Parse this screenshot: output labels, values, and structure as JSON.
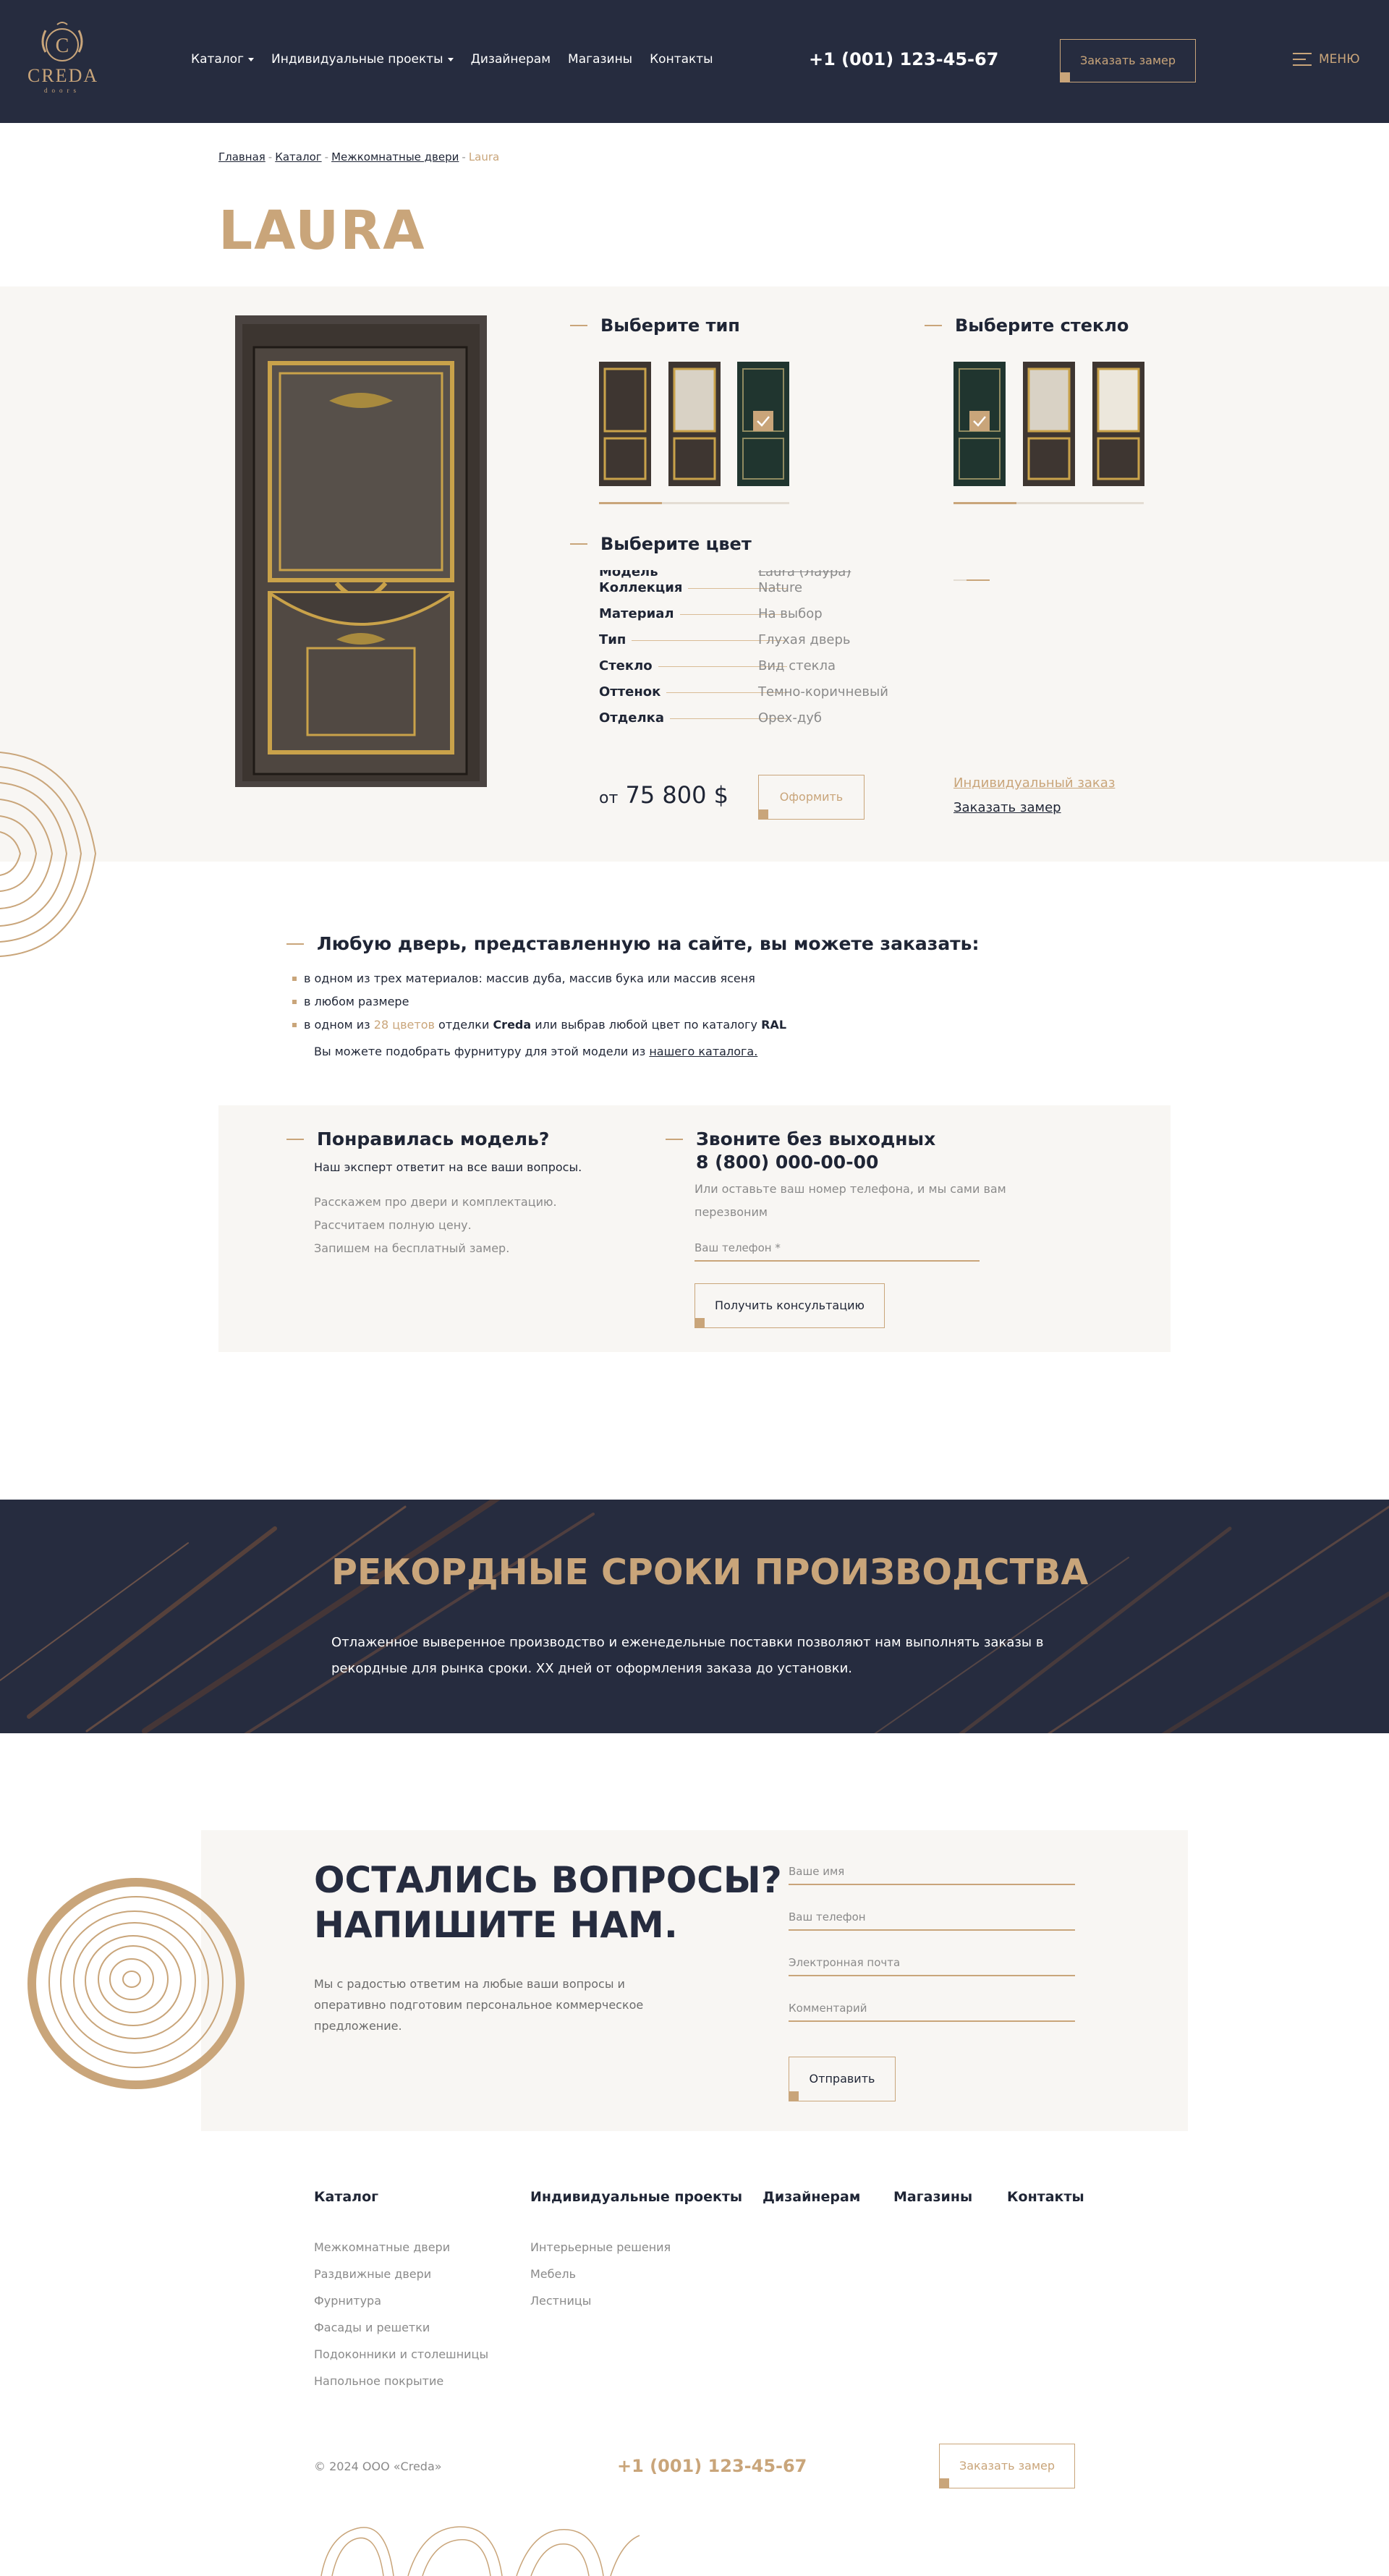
{
  "header": {
    "logo_text": "CREDA",
    "logo_sub": "doors",
    "nav": [
      "Каталог",
      "Индивидуальные проекты",
      "Дизайнерам",
      "Магазины",
      "Контакты"
    ],
    "phone": "+1 (001) 123-45-67",
    "measure_button": "Заказать замер",
    "menu": "МЕНЮ"
  },
  "breadcrumb": [
    "Главная",
    "Каталог",
    "Межкомнатные двери",
    "Laura"
  ],
  "title": "LAURA",
  "product": {
    "type_title": "Выберите тип",
    "glass_title": "Выберите стекло",
    "color_title": "Выберите цвет",
    "specs": [
      {
        "k": "Модель",
        "v": "Laura (Лаура)"
      },
      {
        "k": "Коллекция",
        "v": "Nature"
      },
      {
        "k": "Материал",
        "v": "На выбор"
      },
      {
        "k": "Тип",
        "v": "Глухая дверь"
      },
      {
        "k": "Стекло",
        "v": "Вид стекла"
      },
      {
        "k": "Оттенок",
        "v": "Темно-коричневый"
      },
      {
        "k": "Отделка",
        "v": "Орех-дуб"
      }
    ],
    "price_prefix": "от",
    "price": "75 800 $",
    "order_button": "Оформить",
    "individual_link": "Индивидуальный заказ",
    "measure_link": "Заказать замер",
    "type_progress": 0.33,
    "glass_progress": 0.33
  },
  "order_info": {
    "title": "Любую дверь, представленную на сайте, вы можете заказать:",
    "b1": "в одном из трех материалов: массив дуба, массив бука или массив ясеня",
    "b2": "в любом размере",
    "b3_pre": "в одном из",
    "b3_link": "28 цветов",
    "b3_mid": "отделки",
    "b3_brand": "Creda",
    "b3_mid2": "или выбрав любой цвет по каталогу",
    "b3_ral": "RAL",
    "note_pre": "Вы можете подобрать фурнитуру для этой модели из",
    "note_link": "нашего каталога."
  },
  "consult": {
    "left_title": "Понравилась модель?",
    "left_sub": "Наш эксперт ответит на все ваши вопросы.",
    "left_lines": [
      "Расскажем про двери и комплектацию.",
      "Рассчитаем полную цену.",
      "Запишем на бесплатный замер."
    ],
    "right_title_1": "Звоните без выходных",
    "right_title_2": "8 (800) 000-00-00",
    "right_text": "Или оставьте ваш номер телефона, и мы сами вам перезвоним",
    "phone_placeholder": "Ваш телефон *",
    "button": "Получить консультацию"
  },
  "banner": {
    "title": "РЕКОРДНЫЕ СРОКИ ПРОИЗВОДСТВА",
    "text": "Отлаженное выверенное производство и еженедельные поставки позволяют нам выполнять заказы в рекордные для рынка сроки. ХХ дней от оформления заказа до установки."
  },
  "questions": {
    "title_1": "ОСТАЛИСЬ ВОПРОСЫ?",
    "title_2": "НАПИШИТЕ НАМ.",
    "text": "Мы с радостью ответим на любые ваши вопросы и оперативно подготовим персональное коммерческое предложение.",
    "name": "Ваше имя",
    "phone": "Ваш телефон",
    "email": "Электронная почта",
    "comment": "Комментарий",
    "submit": "Отправить"
  },
  "footer": {
    "col_catalog": "Каталог",
    "catalog_links": [
      "Межкомнатные двери",
      "Раздвижные двери",
      "Фурнитура",
      "Фасады и решетки",
      "Подоконники и столешницы",
      "Напольное покрытие"
    ],
    "col_projects": "Индивидуальные проекты",
    "project_links": [
      "Интерьерные решения",
      "Мебель",
      "Лестницы"
    ],
    "col_designers": "Дизайнерам",
    "col_shops": "Магазины",
    "col_contacts": "Контакты",
    "copyright": "© 2024 ООО «Creda»",
    "phone": "+1 (001) 123-45-67",
    "measure_button": "Заказать замер"
  }
}
